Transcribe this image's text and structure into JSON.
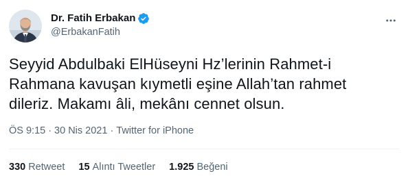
{
  "author": {
    "display_name": "Dr. Fatih Erbakan",
    "handle": "@ErbakanFatih",
    "verified_icon": "verified-badge-icon",
    "avatar_icon": "profile-photo"
  },
  "tweet": {
    "text": "Seyyid Abdulbaki ElHüseyni Hz’lerinin Rahmet-i\nRahmana kavuşan kıymetli eşine Allah’tan rahmet\ndileriz. Makamı âli, mekânı cennet olsun."
  },
  "meta": {
    "time": "ÖS 9:15",
    "separator": "·",
    "date": "30 Nis 2021",
    "source": "Twitter for iPhone"
  },
  "stats": {
    "retweets": {
      "count": "330",
      "label": "Retweet"
    },
    "quotes": {
      "count": "15",
      "label": "Alıntı Tweetler"
    },
    "likes": {
      "count": "1.925",
      "label": "Beğeni"
    }
  },
  "colors": {
    "text": "#0f1419",
    "secondary": "#536471",
    "verified": "#1d9bf0",
    "divider": "#eff3f4"
  },
  "icons": {
    "more": "more-dots-icon"
  }
}
